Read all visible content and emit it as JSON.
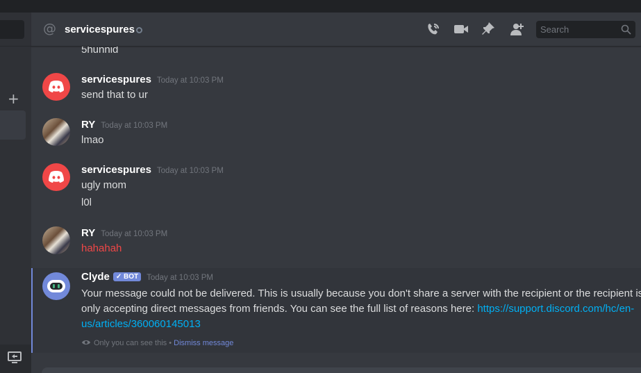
{
  "header": {
    "channel_name": "servicespures",
    "search_placeholder": "Search"
  },
  "messages": [
    {
      "type": "continuation",
      "text": "5hunnid"
    },
    {
      "author": "servicespures",
      "timestamp": "Today at 10:03 PM",
      "lines": [
        "send that to ur"
      ],
      "avatar": "discord-logo"
    },
    {
      "author": "RY",
      "timestamp": "Today at 10:03 PM",
      "lines": [
        "lmao"
      ],
      "avatar": "user-photo"
    },
    {
      "author": "servicespures",
      "timestamp": "Today at 10:03 PM",
      "lines": [
        "ugly mom",
        "l0l"
      ],
      "avatar": "discord-logo"
    },
    {
      "author": "RY",
      "timestamp": "Today at 10:03 PM",
      "lines": [
        "hahahah"
      ],
      "avatar": "user-photo",
      "text_color": "#f04747"
    }
  ],
  "clyde": {
    "author": "Clyde",
    "badge": "✓ BOT",
    "timestamp": "Today at 10:03 PM",
    "text": "Your message could not be delivered. This is usually because you don't share a server with the recipient or the recipient is only accepting direct messages from friends. You can see the full list of reasons here: ",
    "link": "https://support.discord.com/hc/en-us/articles/360060145013",
    "only_you": "Only you can see this",
    "separator": "•",
    "dismiss": "Dismiss message"
  },
  "sidebar": {
    "plus": "+"
  },
  "colors": {
    "accent": "#7289da",
    "red": "#f04747",
    "link": "#00b0f4"
  }
}
